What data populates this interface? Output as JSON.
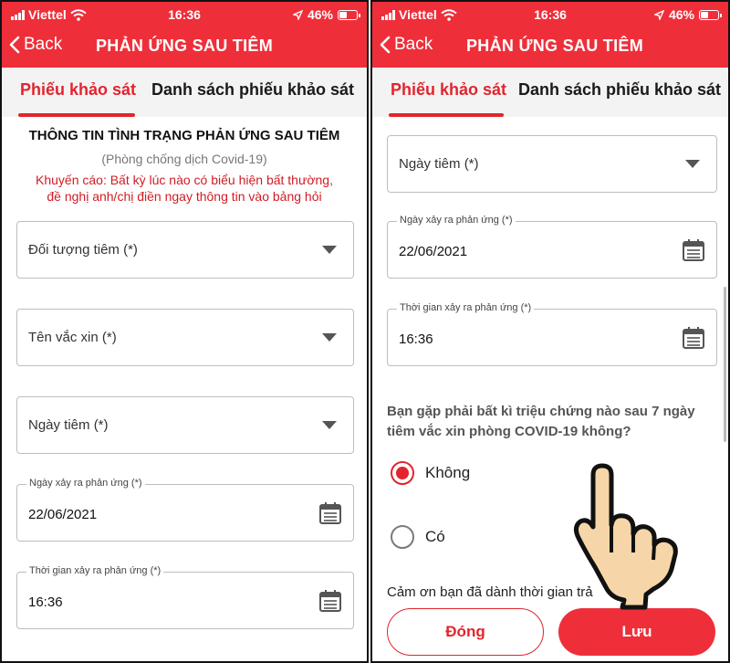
{
  "status": {
    "carrier": "Viettel",
    "time": "16:36",
    "battery": "46%"
  },
  "nav": {
    "back": "Back",
    "title": "PHẢN ỨNG SAU TIÊM"
  },
  "tabs": {
    "survey": "Phiếu khảo sát",
    "list": "Danh sách phiếu khảo sát"
  },
  "left": {
    "heading": "THÔNG TIN TÌNH TRẠNG PHẢN ỨNG SAU TIÊM",
    "subheading": "(Phòng chống dịch Covid-19)",
    "warning_line1": "Khuyến cáo: Bất kỳ lúc nào có biểu hiện bất thường,",
    "warning_line2": "đề nghị  anh/chị điền ngay thông tin vào bảng hỏi",
    "field_target": "Đối tượng tiêm (*)",
    "field_vaccine": "Tên vắc xin (*)",
    "field_inject_date": "Ngày tiêm (*)",
    "reaction_date_label": "Ngày xảy ra phản ứng (*)",
    "reaction_date_value": "22/06/2021",
    "reaction_time_label": "Thời gian xảy ra phản ứng (*)",
    "reaction_time_value": "16:36"
  },
  "right": {
    "field_inject_date": "Ngày tiêm (*)",
    "reaction_date_label": "Ngày xảy ra phản ứng (*)",
    "reaction_date_value": "22/06/2021",
    "reaction_time_label": "Thời gian xảy ra phản ứng (*)",
    "reaction_time_value": "16:36",
    "question_line1": "Bạn gặp phải bất kì triệu chứng nào sau 7 ngày",
    "question_line2": "tiêm vắc xin phòng COVID-19 không?",
    "option_no": "Không",
    "option_yes": "Có",
    "thanks": "Cảm ơn bạn đã dành thời gian trả",
    "btn_close": "Đóng",
    "btn_save": "Lưu"
  },
  "colors": {
    "brand": "#ee2f3a",
    "accent": "#e3242f",
    "warning": "#d01c24"
  },
  "icons": [
    "wifi-icon",
    "signal-icon",
    "battery-icon",
    "location-icon",
    "back-chevron-icon",
    "dropdown-caret-icon",
    "calendar-icon",
    "pointing-hand-icon"
  ]
}
